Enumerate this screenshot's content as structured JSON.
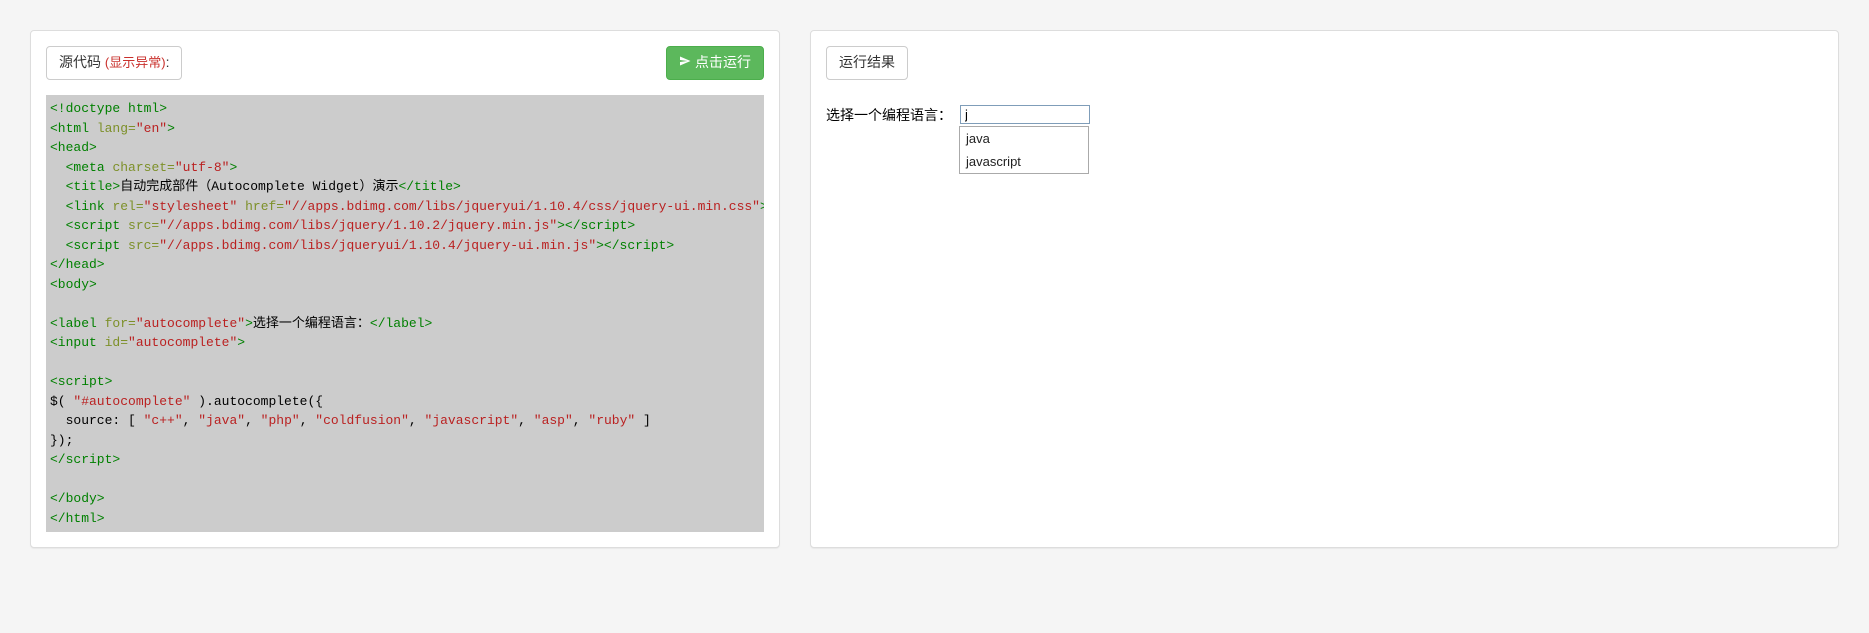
{
  "left": {
    "source_label": "源代码",
    "error_link": "(显示异常)",
    "colon": ":",
    "run_button": "点击运行",
    "code_html": "<span class=\"tag\">&lt;!doctype html&gt;</span>\n<span class=\"tag\">&lt;html</span> <span class=\"attr-name\">lang=</span><span class=\"attr-value\">\"en\"</span><span class=\"tag\">&gt;</span>\n<span class=\"tag\">&lt;head&gt;</span>\n  <span class=\"tag\">&lt;meta</span> <span class=\"attr-name\">charset=</span><span class=\"attr-value\">\"utf-8\"</span><span class=\"tag\">&gt;</span>\n  <span class=\"tag\">&lt;title&gt;</span><span class=\"text\">自动完成部件（Autocomplete Widget）演示</span><span class=\"tag\">&lt;/title&gt;</span>\n  <span class=\"tag\">&lt;link</span> <span class=\"attr-name\">rel=</span><span class=\"attr-value\">\"stylesheet\"</span> <span class=\"attr-name\">href=</span><span class=\"attr-value\">\"//apps.bdimg.com/libs/jqueryui/1.10.4/css/jquery-ui.min.css\"</span><span class=\"tag\">&gt;</span>\n  <span class=\"tag\">&lt;script</span> <span class=\"attr-name\">src=</span><span class=\"attr-value\">\"//apps.bdimg.com/libs/jquery/1.10.2/jquery.min.js\"</span><span class=\"tag\">&gt;&lt;/script&gt;</span>\n  <span class=\"tag\">&lt;script</span> <span class=\"attr-name\">src=</span><span class=\"attr-value\">\"//apps.bdimg.com/libs/jqueryui/1.10.4/jquery-ui.min.js\"</span><span class=\"tag\">&gt;&lt;/script&gt;</span>\n<span class=\"tag\">&lt;/head&gt;</span>\n<span class=\"tag\">&lt;body&gt;</span>\n \n<span class=\"tag\">&lt;label</span> <span class=\"attr-name\">for=</span><span class=\"attr-value\">\"autocomplete\"</span><span class=\"tag\">&gt;</span><span class=\"text\">选择一个编程语言：</span><span class=\"tag\">&lt;/label&gt;</span>\n<span class=\"tag\">&lt;input</span> <span class=\"attr-name\">id=</span><span class=\"attr-value\">\"autocomplete\"</span><span class=\"tag\">&gt;</span>\n \n<span class=\"tag\">&lt;script&gt;</span>\n<span class=\"text\">$( </span><span class=\"attr-value\">\"#autocomplete\"</span><span class=\"text\"> ).autocomplete({</span>\n<span class=\"text\">  source: [ </span><span class=\"attr-value\">\"c++\"</span><span class=\"text\">, </span><span class=\"attr-value\">\"java\"</span><span class=\"text\">, </span><span class=\"attr-value\">\"php\"</span><span class=\"text\">, </span><span class=\"attr-value\">\"coldfusion\"</span><span class=\"text\">, </span><span class=\"attr-value\">\"javascript\"</span><span class=\"text\">, </span><span class=\"attr-value\">\"asp\"</span><span class=\"text\">, </span><span class=\"attr-value\">\"ruby\"</span><span class=\"text\"> ]</span>\n<span class=\"text\">});</span>\n<span class=\"tag\">&lt;/script&gt;</span>\n \n<span class=\"tag\">&lt;/body&gt;</span>\n<span class=\"tag\">&lt;/html&gt;</span>"
  },
  "right": {
    "result_button": "运行结果",
    "autocomplete_label": "选择一个编程语言：",
    "input_value": "j",
    "dropdown_items": [
      "java",
      "javascript"
    ]
  }
}
